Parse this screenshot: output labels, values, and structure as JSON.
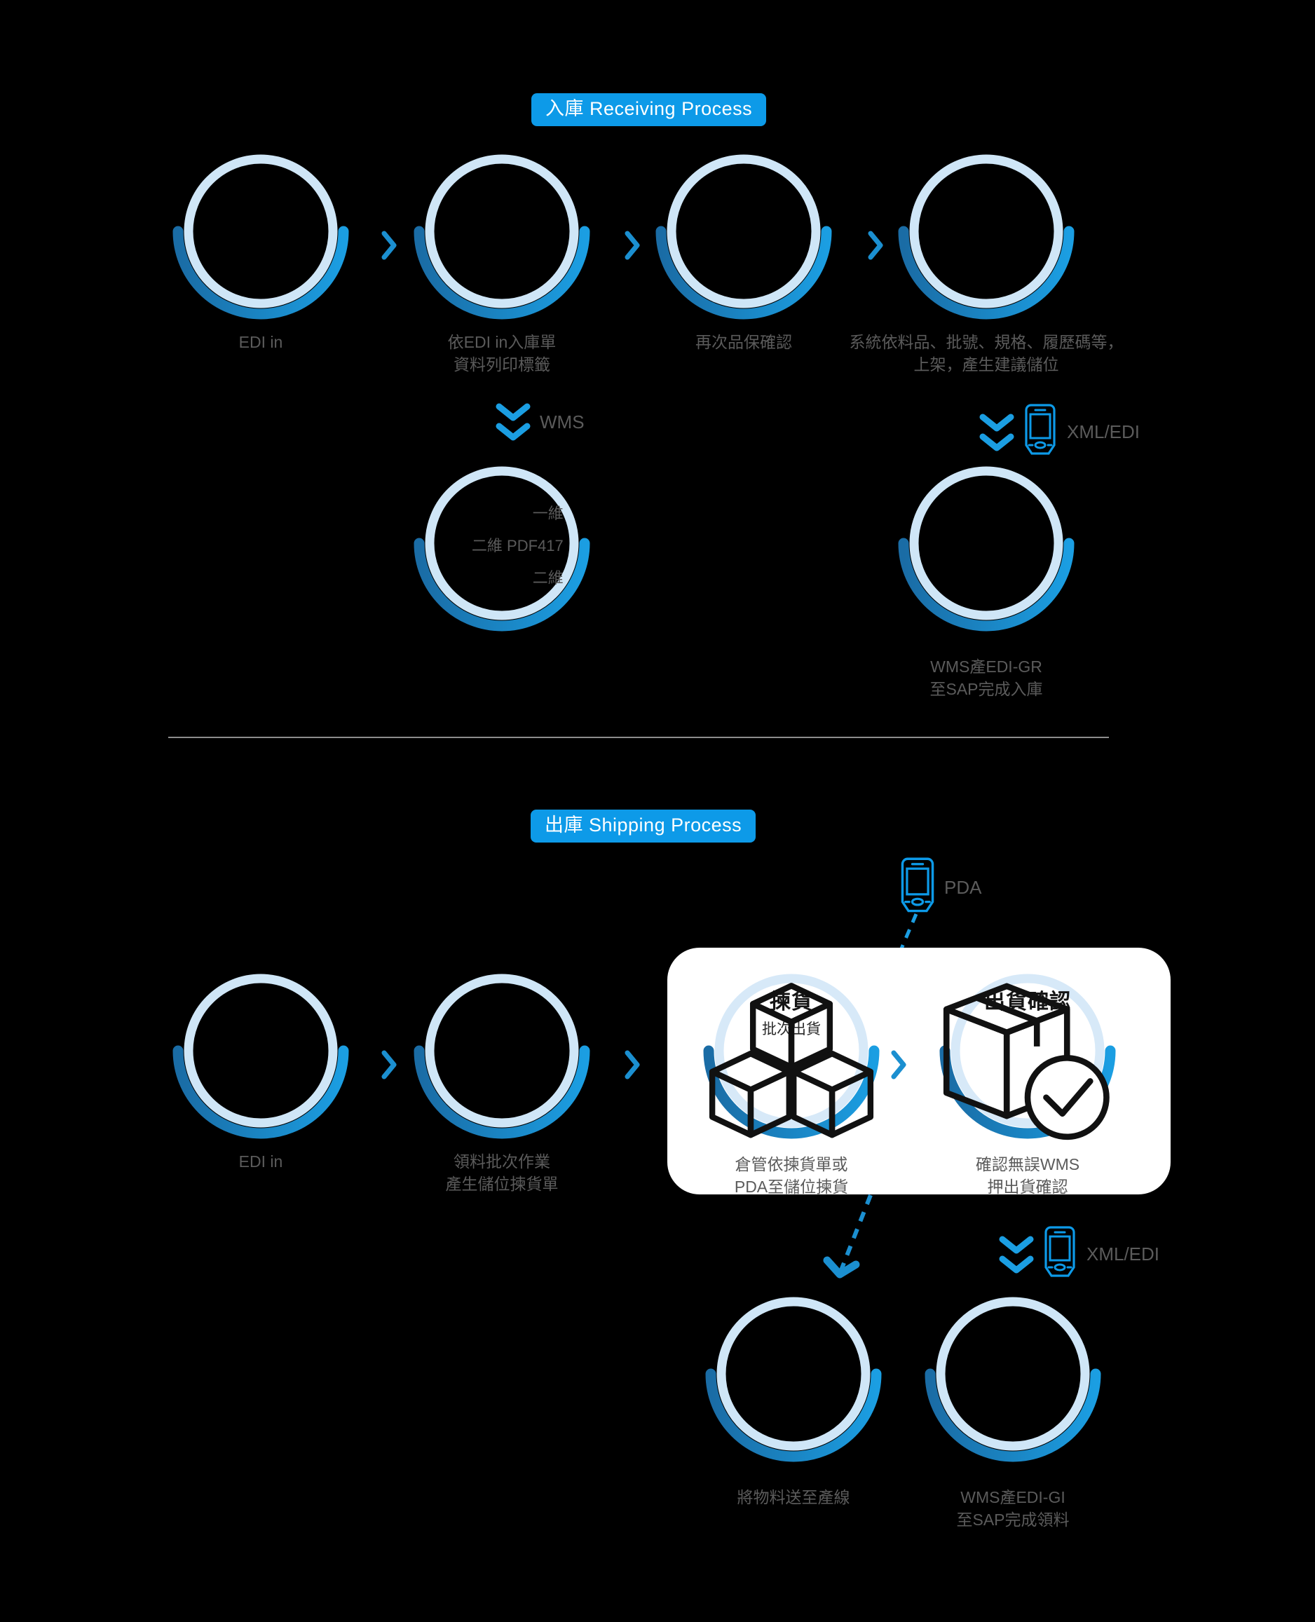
{
  "colors": {
    "background": "#000000",
    "accent": "#0d9ae8",
    "ring_inner": "#cfe6f7",
    "arc_left": "#1a6ca5",
    "arc_right": "#1b9ee2",
    "label_text": "#5b5b5b",
    "divider": "#8d8d8d",
    "card_background": "#ffffff"
  },
  "receiving": {
    "pill_label": "入庫 Receiving Process",
    "steps": [
      {
        "label": "EDI in",
        "icon": "edi-in-icon"
      },
      {
        "label_line1": "依EDI in入庫單",
        "label_line2": "資料列印標籤",
        "icon": "printer-label-icon"
      },
      {
        "label": "再次品保確認",
        "icon": "quality-check-icon"
      },
      {
        "label_line1": "系統依料品、批號、規格、履歷碼等，",
        "label_line2": "上架，產生建議儲位",
        "icon": "shelf-putaway-icon"
      }
    ],
    "wms_connector": {
      "label": "WMS",
      "icon": "double-chevron-down-icon"
    },
    "barcode_node": {
      "icon": "barcode-icon",
      "items": [
        "一維",
        "二維  PDF417",
        "二維"
      ]
    },
    "xmledi_connector": {
      "label": "XML/EDI",
      "icon": "pda-icon"
    },
    "sap_node": {
      "label_line1": "WMS產EDI-GR",
      "label_line2": "至SAP完成入庫",
      "icon": "sap-server-icon"
    }
  },
  "shipping": {
    "pill_label": "出庫 Shipping Process",
    "pda_callout": {
      "label": "PDA",
      "icon": "pda-icon"
    },
    "steps": [
      {
        "label": "EDI in",
        "icon": "edi-in-icon"
      },
      {
        "label_line1": "領料批次作業",
        "label_line2": "產生儲位揀貨單",
        "icon": "batch-picking-icon"
      }
    ],
    "card_steps": [
      {
        "title": "揀貨",
        "subtitle": "批次出貨",
        "icon": "boxes-icon",
        "label_line1": "倉管依揀貨單或",
        "label_line2": "PDA至儲位揀貨"
      },
      {
        "title": "出貨確認",
        "subtitle": "",
        "icon": "box-check-icon",
        "label_line1": "確認無誤WMS",
        "label_line2": "押出貨確認"
      }
    ],
    "xmledi_connector": {
      "label": "XML/EDI",
      "icon": "pda-icon"
    },
    "bottom_nodes": [
      {
        "label_line1": "將物料送至產線",
        "label_line2": "",
        "icon": "delivery-icon"
      },
      {
        "label_line1": "WMS產EDI-GI",
        "label_line2": "至SAP完成領料",
        "icon": "sap-server-icon"
      }
    ]
  }
}
